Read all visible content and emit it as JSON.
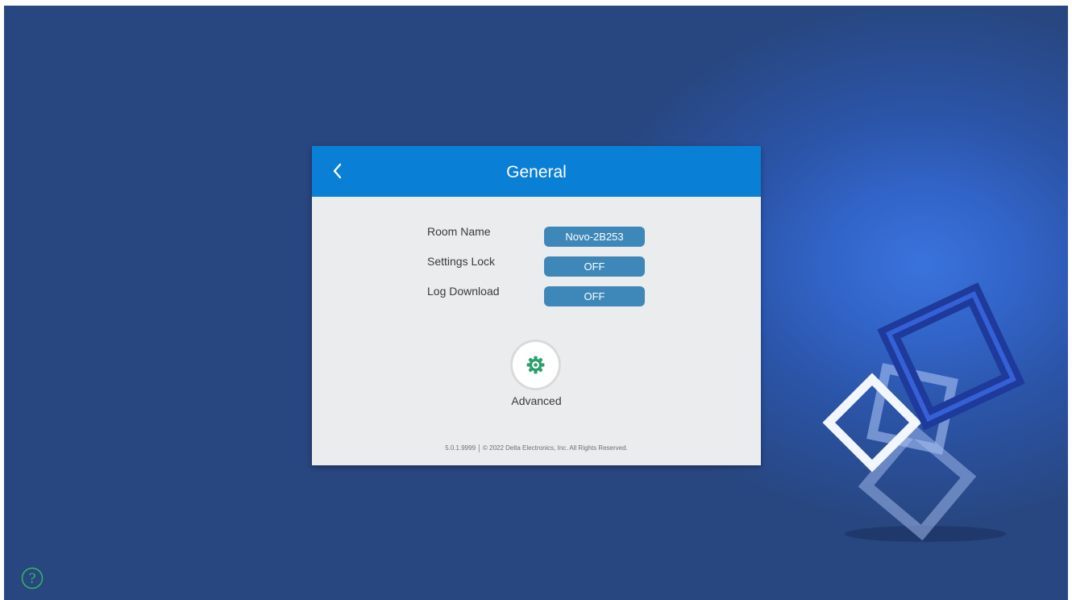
{
  "dialog": {
    "title": "General",
    "rows": [
      {
        "label": "Room Name",
        "value": "Novo-2B253"
      },
      {
        "label": "Settings Lock",
        "value": "OFF"
      },
      {
        "label": "Log Download",
        "value": "OFF"
      }
    ],
    "advanced_label": "Advanced",
    "footer": {
      "version": "5.0.1.9999",
      "copyright": "© 2022 Delta Electronics, Inc. All Rights Reserved."
    }
  },
  "help": {
    "glyph": "?"
  },
  "icons": {
    "back": "chevron-left-icon",
    "advanced": "gear-icon",
    "help": "question-icon"
  },
  "colors": {
    "background": "#28467f",
    "header": "#0a7fd6",
    "pill": "#3d88b9",
    "gear": "#2aa06b",
    "help": "#35b85f"
  }
}
